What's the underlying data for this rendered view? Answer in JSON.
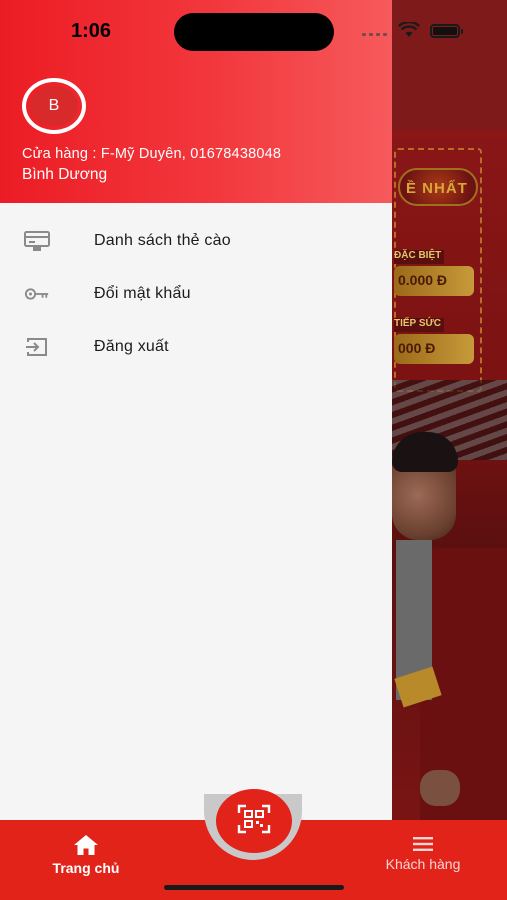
{
  "status_bar": {
    "time": "1:06"
  },
  "drawer": {
    "avatar_initial": "B",
    "store_info": "Cửa hàng : F-Mỹ Duyên, 01678438048",
    "region": "Bình Dương",
    "menu": [
      {
        "label": "Danh sách thẻ cào",
        "icon": "card-list-icon"
      },
      {
        "label": "Đổi mật khẩu",
        "icon": "key-icon"
      },
      {
        "label": "Đăng xuất",
        "icon": "logout-icon"
      }
    ]
  },
  "background_banner": {
    "logo_text": "Ề NHẤT",
    "prize1_tag": "ĐẶC BIỆT",
    "prize1_value": "0.000 Đ",
    "prize2_tag": "TIẾP SỨC",
    "prize2_value": "000 Đ"
  },
  "bottom_nav": {
    "home_label": "Trang chủ",
    "home_icon": "home-icon",
    "scan_icon": "qr-scan-icon",
    "customers_label": "Khách hàng",
    "customers_icon": "menu-icon"
  },
  "colors": {
    "primary": "#e2231a",
    "header_gradient_start": "#ec1c24",
    "header_gradient_end": "#f65a5c",
    "drawer_bg": "#f5f5f5"
  }
}
